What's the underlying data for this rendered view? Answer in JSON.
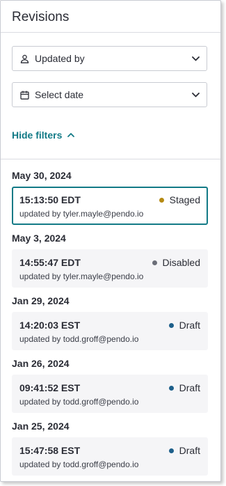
{
  "panel": {
    "title": "Revisions"
  },
  "filters": {
    "updated_by": {
      "label": "Updated by",
      "icon": "user-icon"
    },
    "select_date": {
      "label": "Select date",
      "icon": "calendar-icon"
    },
    "hide_label": "Hide filters"
  },
  "colors": {
    "accent": "#127a86",
    "staged": "#b58a13",
    "disabled": "#6b6e78",
    "draft": "#1d5f8a"
  },
  "revisions": [
    {
      "date": "May 30, 2024",
      "time": "15:13:50 EDT",
      "status": "Staged",
      "status_color": "#b58a13",
      "updated_by": "updated by tyler.mayle@pendo.io",
      "selected": true
    },
    {
      "date": "May 3, 2024",
      "time": "14:55:47 EDT",
      "status": "Disabled",
      "status_color": "#6b6e78",
      "updated_by": "updated by tyler.mayle@pendo.io",
      "selected": false
    },
    {
      "date": "Jan 29, 2024",
      "time": "14:20:03 EST",
      "status": "Draft",
      "status_color": "#1d5f8a",
      "updated_by": "updated by todd.groff@pendo.io",
      "selected": false
    },
    {
      "date": "Jan 26, 2024",
      "time": "09:41:52 EST",
      "status": "Draft",
      "status_color": "#1d5f8a",
      "updated_by": "updated by todd.groff@pendo.io",
      "selected": false
    },
    {
      "date": "Jan 25, 2024",
      "time": "15:47:58 EST",
      "status": "Draft",
      "status_color": "#1d5f8a",
      "updated_by": "updated by todd.groff@pendo.io",
      "selected": false
    }
  ]
}
